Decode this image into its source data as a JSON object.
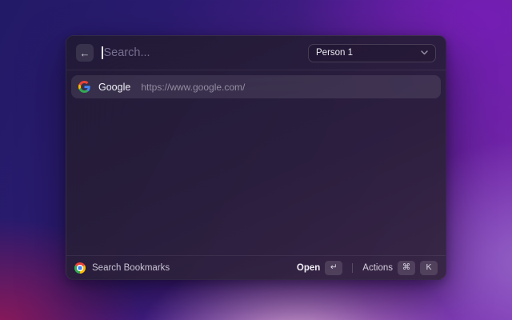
{
  "colors": {
    "google_blue": "#4285F4",
    "google_red": "#EA4335",
    "google_yellow": "#FBBC05",
    "google_green": "#34A853",
    "background_top_left": "#221a66",
    "background_top_right": "#7b2ab2",
    "background_bottom_pink": "#d8a8d4",
    "background_bottom_crimson": "#981856"
  },
  "icons": {
    "back": "←",
    "return_key": "↵",
    "command_key": "⌘"
  },
  "launcher": {
    "search": {
      "placeholder": "Search...",
      "value": ""
    },
    "profile": {
      "selected": "Person 1"
    },
    "results": [
      {
        "icon": "google-favicon",
        "title": "Google",
        "url": "https://www.google.com/"
      }
    ],
    "footer": {
      "source_icon": "chrome-icon",
      "source_label": "Search Bookmarks",
      "open_label": "Open",
      "open_key": "↵",
      "actions_label": "Actions",
      "actions_keys": [
        "⌘",
        "K"
      ]
    }
  }
}
